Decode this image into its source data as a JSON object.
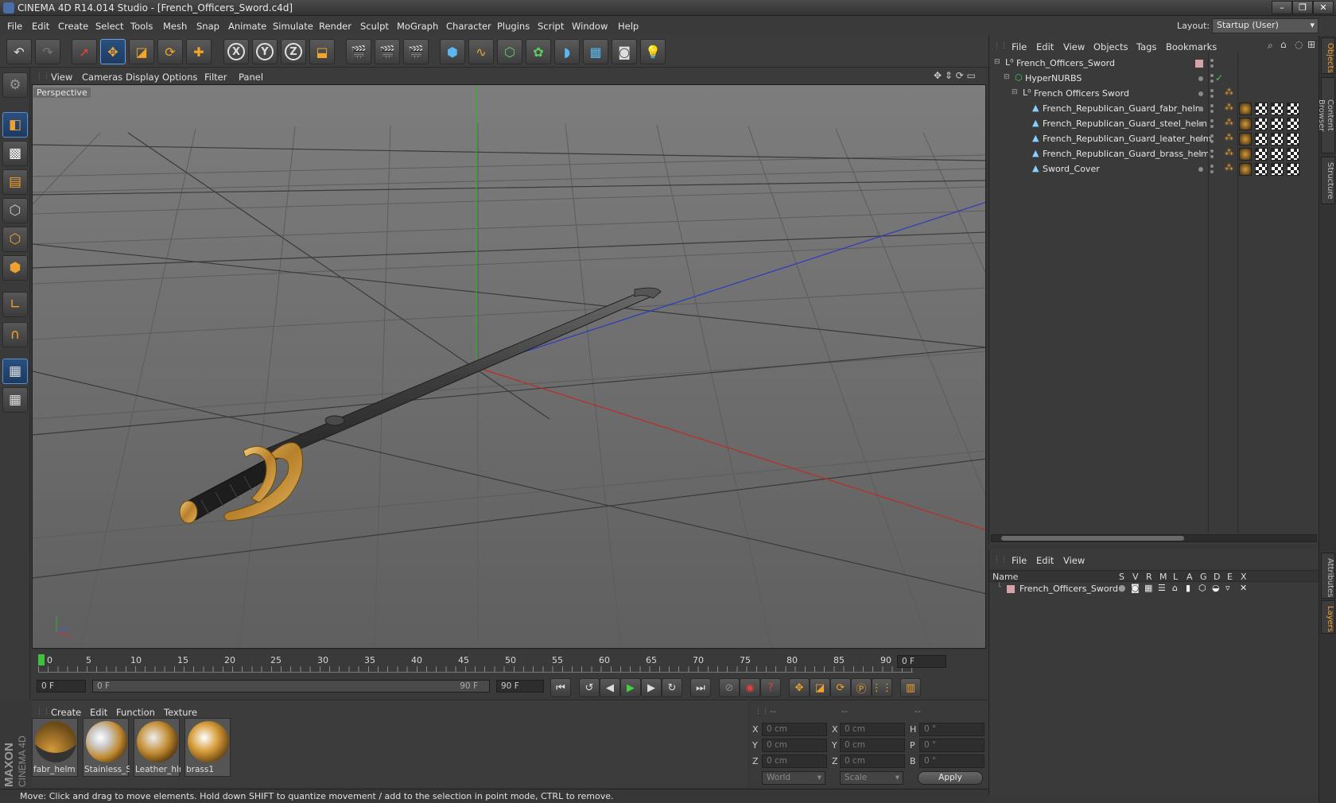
{
  "window": {
    "title": "CINEMA 4D R14.014 Studio - [French_Officers_Sword.c4d]"
  },
  "menu": [
    "File",
    "Edit",
    "Create",
    "Select",
    "Tools",
    "Mesh",
    "Snap",
    "Animate",
    "Simulate",
    "Render",
    "Sculpt",
    "MoGraph",
    "Character",
    "Plugins",
    "Script",
    "Window",
    "Help"
  ],
  "layout": {
    "label": "Layout:",
    "value": "Startup (User)"
  },
  "viewport": {
    "menu": [
      "View",
      "Cameras",
      "Display",
      "Options",
      "Filter",
      "Panel"
    ],
    "label": "Perspective"
  },
  "timeline": {
    "ticks": [
      "0",
      "5",
      "10",
      "15",
      "20",
      "25",
      "30",
      "35",
      "40",
      "45",
      "50",
      "55",
      "60",
      "65",
      "70",
      "75",
      "80",
      "85",
      "90"
    ],
    "current": "0 F"
  },
  "transport": {
    "start": "0 F",
    "range_start": "0 F",
    "range_end": "90 F",
    "end": "90 F"
  },
  "materials": {
    "menu": [
      "Create",
      "Edit",
      "Function",
      "Texture"
    ],
    "items": [
      {
        "label": "fabr_helm"
      },
      {
        "label": "Stainless_S"
      },
      {
        "label": "Leather_hlr"
      },
      {
        "label": "brass1"
      }
    ]
  },
  "coords": {
    "header": [
      "--",
      "--",
      "--"
    ],
    "rows": [
      {
        "a": "X",
        "av": "0 cm",
        "b": "X",
        "bv": "0 cm",
        "c": "H",
        "cv": "0 °"
      },
      {
        "a": "Y",
        "av": "0 cm",
        "b": "Y",
        "bv": "0 cm",
        "c": "P",
        "cv": "0 °"
      },
      {
        "a": "Z",
        "av": "0 cm",
        "b": "Z",
        "bv": "0 cm",
        "c": "B",
        "cv": "0 °"
      }
    ],
    "world": "World",
    "scale": "Scale",
    "apply": "Apply"
  },
  "status": "Move: Click and drag to move elements. Hold down SHIFT to quantize movement / add to the selection in point mode, CTRL to remove.",
  "object_manager": {
    "menu": [
      "File",
      "Edit",
      "View",
      "Objects",
      "Tags",
      "Bookmarks"
    ],
    "objects": [
      {
        "name": "French_Officers_Sword"
      },
      {
        "name": "HyperNURBS"
      },
      {
        "name": "French Officers Sword"
      },
      {
        "name": "French_Republican_Guard_fabr_helm"
      },
      {
        "name": "French_Republican_Guard_steel_helm"
      },
      {
        "name": "French_Republican_Guard_leater_helm"
      },
      {
        "name": "French_Republican_Guard_brass_helm"
      },
      {
        "name": "Sword_Cover"
      }
    ]
  },
  "layer_manager": {
    "menu": [
      "File",
      "Edit",
      "View"
    ],
    "columns": [
      "Name",
      "S",
      "V",
      "R",
      "M",
      "L",
      "A",
      "G",
      "D",
      "E",
      "X"
    ],
    "row": "French_Officers_Sword"
  },
  "side_tabs": [
    "Objects",
    "Content Browser",
    "Structure",
    "Attributes",
    "Layers"
  ],
  "colors": {
    "accent": "#f0a030",
    "axis_x": "#c03030",
    "axis_y": "#30b030",
    "axis_z": "#3040c0"
  }
}
